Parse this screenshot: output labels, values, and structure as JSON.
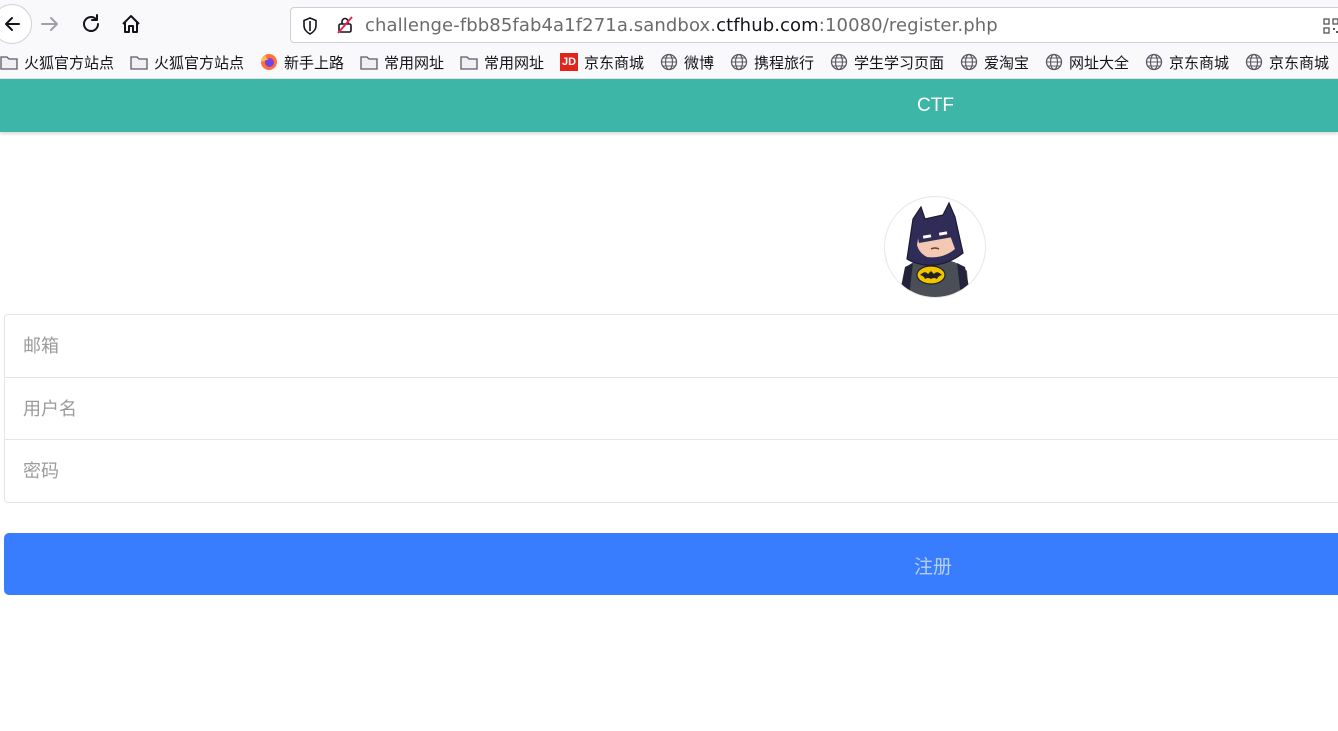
{
  "browser": {
    "url_prefix": "challenge-fbb85fab4a1f271a.sandbox.",
    "url_domain": "ctfhub.com",
    "url_suffix": ":10080/register.php"
  },
  "bookmarks": [
    {
      "label": "火狐官方站点",
      "icon": "folder-icon"
    },
    {
      "label": "火狐官方站点",
      "icon": "folder-icon"
    },
    {
      "label": "新手上路",
      "icon": "firefox-icon"
    },
    {
      "label": "常用网址",
      "icon": "folder-icon"
    },
    {
      "label": "常用网址",
      "icon": "folder-icon"
    },
    {
      "label": "京东商城",
      "icon": "jd-icon",
      "icon_text": "JD"
    },
    {
      "label": "微博",
      "icon": "globe-icon"
    },
    {
      "label": "携程旅行",
      "icon": "globe-icon"
    },
    {
      "label": "学生学习页面",
      "icon": "globe-icon"
    },
    {
      "label": "爱淘宝",
      "icon": "globe-icon"
    },
    {
      "label": "网址大全",
      "icon": "globe-icon"
    },
    {
      "label": "京东商城",
      "icon": "globe-icon"
    },
    {
      "label": "京东商城",
      "icon": "globe-icon"
    }
  ],
  "header": {
    "title": "CTF",
    "color": "#3db5a7"
  },
  "avatar": {
    "icon": "batman-avatar-icon"
  },
  "form": {
    "email_placeholder": "邮箱",
    "username_placeholder": "用户名",
    "password_placeholder": "密码",
    "submit_label": "注册",
    "submit_color": "#387dfd"
  }
}
